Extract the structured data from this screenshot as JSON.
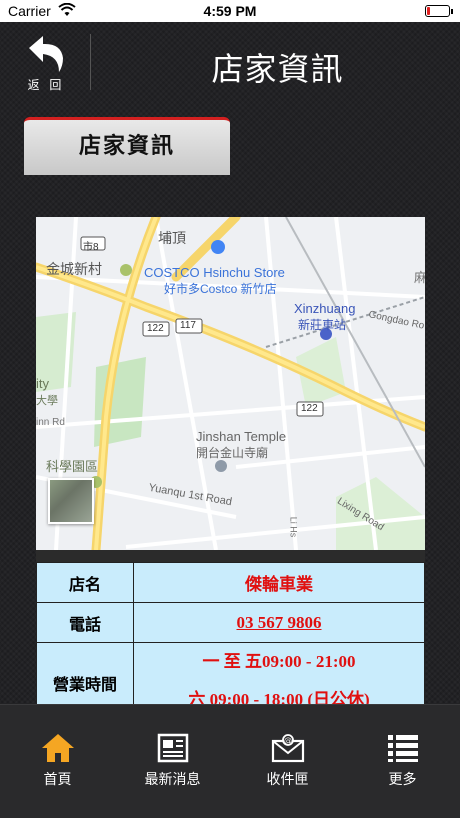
{
  "status_bar": {
    "carrier": "Carrier",
    "time": "4:59 PM",
    "battery_level": 0.12
  },
  "nav": {
    "back_label": "返 回",
    "title": "店家資訊"
  },
  "section_tab": {
    "label": "店家資訊"
  },
  "map": {
    "labels": {
      "puding": "埔頂",
      "route8": "市8",
      "jincheng": "金城新村",
      "costco_en": "COSTCO Hsinchu Store",
      "costco_zh": "好市多Costco 新竹店",
      "xinzhuang_en": "Xinzhuang",
      "xinzhuang_zh": "新莊車站",
      "gongdao": "Gongdao Ro",
      "road122a": "122",
      "road117": "117",
      "road122b": "122",
      "jinshan_en": "Jinshan Temple",
      "jinshan_zh": "開台金山寺廟",
      "yuanqu": "Yuanqu 1st Road",
      "lixing": "Lixing Road",
      "science": "科學園區",
      "ity": "ity",
      "nnrd": "inn Rd",
      "xue": "大學",
      "li": "Li Hs",
      "ma": "麻"
    }
  },
  "store": {
    "name_label": "店名",
    "name": "傑輪車業",
    "phone_label": "電話",
    "phone": "03 567 9806",
    "hours_label": "營業時間",
    "hours_weekday": "一 至 五09:00 - 21:00",
    "hours_saturday": "六 09:00 - 18:00 (日公休)"
  },
  "tabbar": {
    "home": "首頁",
    "news": "最新消息",
    "inbox": "收件匣",
    "more": "更多"
  },
  "colors": {
    "accent_red": "#d32020",
    "home_orange": "#f5a623",
    "table_bg": "#c9ecfc"
  }
}
